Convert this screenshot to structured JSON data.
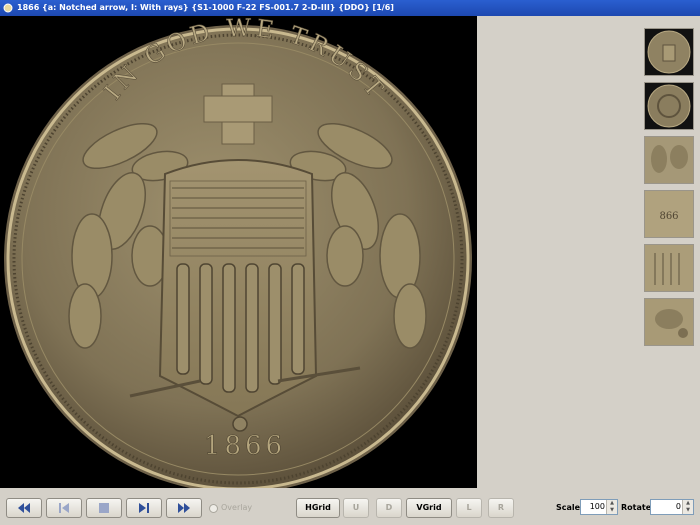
{
  "window": {
    "title": "1866 {a: Notched arrow, I: With rays} {S1-1000 F-22 FS-001.7 2-D-III} {DDO}     [1/6]"
  },
  "coin": {
    "legend": "IN GOD WE TRUST",
    "date": "1866"
  },
  "thumbnails": [
    {
      "name": "thumb-obverse"
    },
    {
      "name": "thumb-reverse"
    },
    {
      "name": "thumb-detail-1"
    },
    {
      "name": "thumb-detail-2"
    },
    {
      "name": "thumb-detail-3"
    },
    {
      "name": "thumb-detail-4"
    }
  ],
  "controls": {
    "overlay_label": "Overlay",
    "hgrid_label": "HGrid",
    "u_label": "U",
    "d_label": "D",
    "vgrid_label": "VGrid",
    "l_label": "L",
    "r_label": "R",
    "scale_label": "Scale",
    "scale_value": "100",
    "rotate_label": "Rotate",
    "rotate_value": "0"
  },
  "icons": [
    "first-icon",
    "previous-icon",
    "stop-icon",
    "next-icon",
    "last-icon"
  ],
  "colors": {
    "titlebar": "#2359c4",
    "window_bg": "#d4d0c8",
    "viewer_bg": "#000000"
  }
}
